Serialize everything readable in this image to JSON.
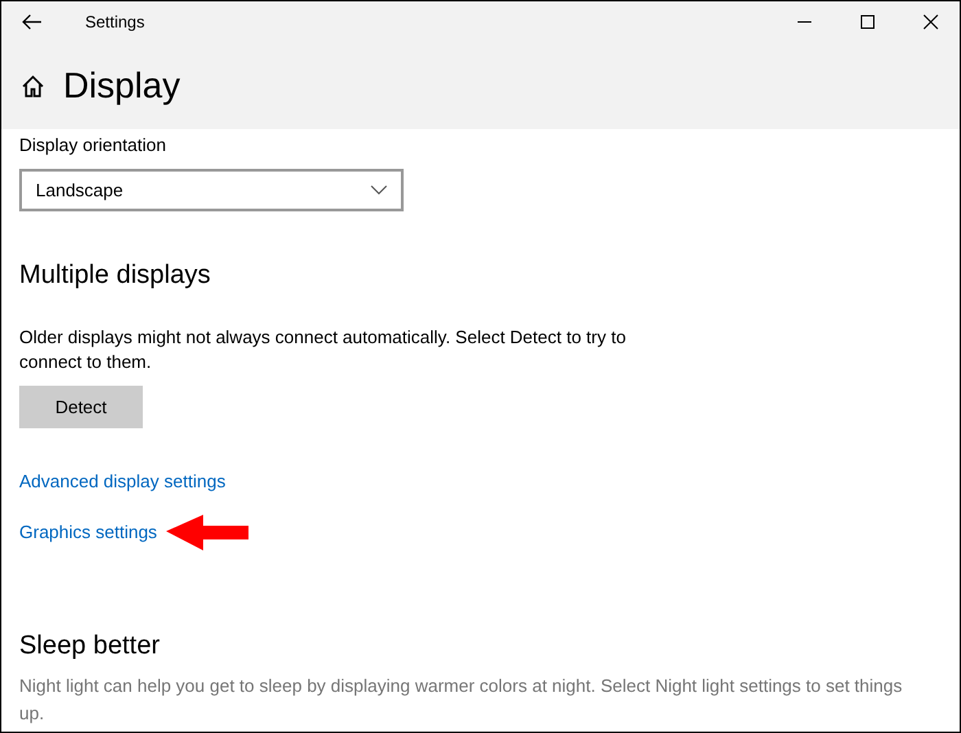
{
  "window": {
    "title": "Settings"
  },
  "page": {
    "title": "Display"
  },
  "orientation": {
    "label": "Display orientation",
    "value": "Landscape"
  },
  "multiple_displays": {
    "heading": "Multiple displays",
    "description": "Older displays might not always connect automatically. Select Detect to try to connect to them.",
    "button": "Detect",
    "links": [
      "Advanced display settings",
      "Graphics settings"
    ]
  },
  "sleep_better": {
    "heading": "Sleep better",
    "description": "Night light can help you get to sleep by displaying warmer colors at night. Select Night light settings to set things up."
  }
}
